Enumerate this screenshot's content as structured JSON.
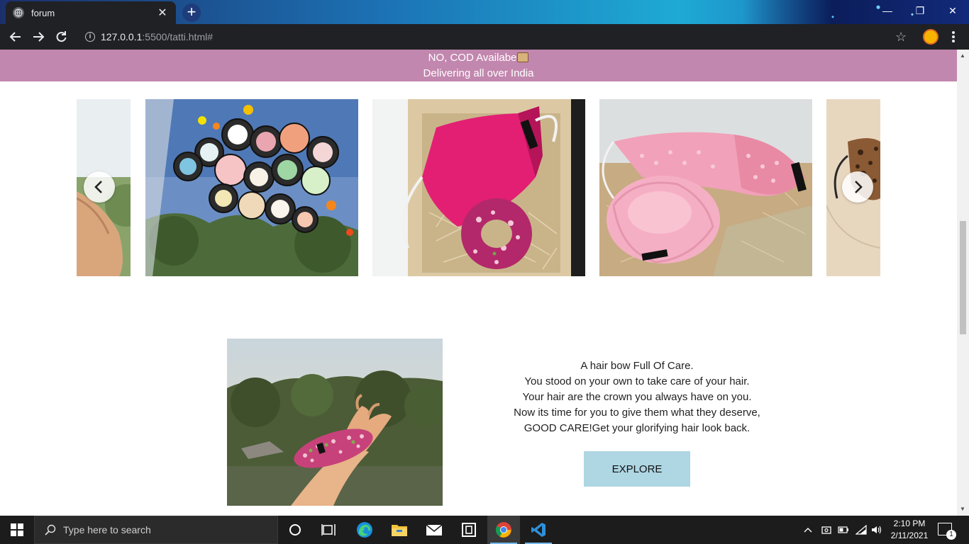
{
  "browser": {
    "tab_title": "forum",
    "url_host": "127.0.0.1",
    "url_path": ":5500/tatti.html#"
  },
  "page": {
    "banner_line1": "NO, COD Availabe",
    "banner_line2": "Delivering all over India",
    "carousel": {
      "slides": [
        {
          "description": "hand holding product",
          "icon": "photo"
        },
        {
          "description": "cosmetic jars",
          "icon": "photo"
        },
        {
          "description": "pink mask and floral scrunchie",
          "icon": "photo"
        },
        {
          "description": "pink eyelet mask and pink scrunchie",
          "icon": "photo"
        },
        {
          "description": "leopard print mask",
          "icon": "photo"
        }
      ]
    },
    "feature": {
      "lines": [
        "A hair bow Full Of Care.",
        "You stood on your own to take care of your hair.",
        "Your hair are the crown you always have on you.",
        "Now its time for you to give them what they deserve,",
        "GOOD CARE!Get your glorifying hair look back."
      ],
      "button_label": "EXPLORE"
    },
    "colors": {
      "banner": "#c287ae",
      "explore_button": "#aed6e3"
    }
  },
  "taskbar": {
    "search_placeholder": "Type here to search",
    "time": "2:10 PM",
    "date": "2/11/2021",
    "notification_count": "1"
  }
}
